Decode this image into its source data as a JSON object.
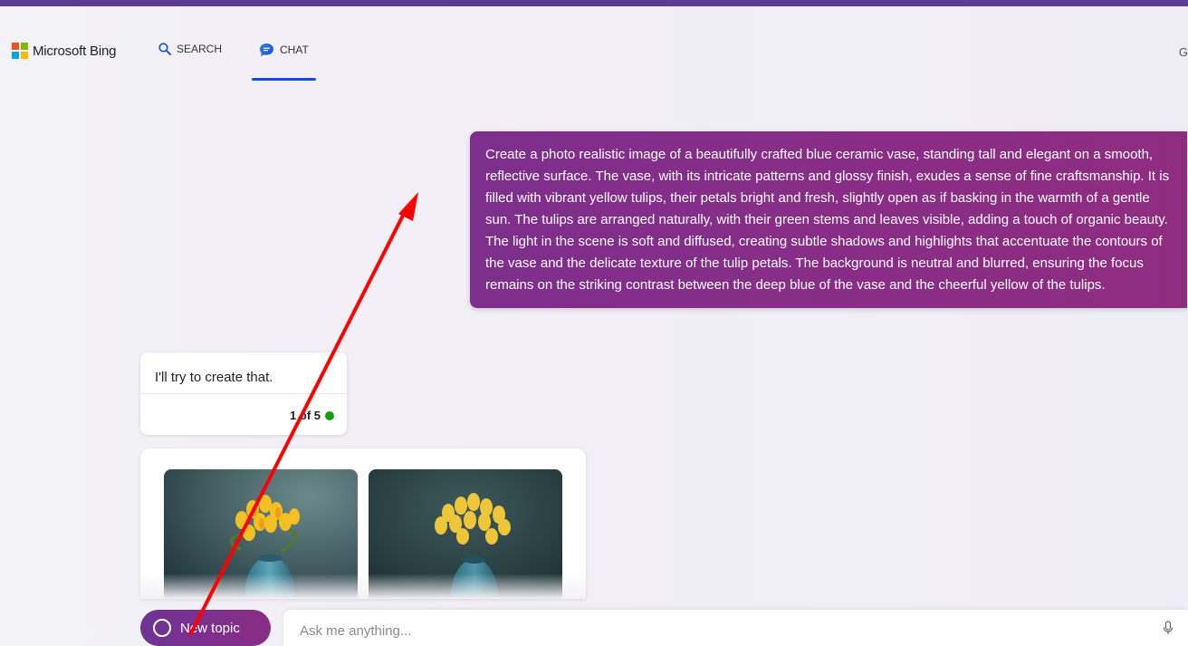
{
  "header": {
    "brand": "Microsoft Bing",
    "nav": {
      "search_label": "SEARCH",
      "chat_label": "CHAT"
    },
    "user_initial": "G"
  },
  "conversation": {
    "user_message": "Create a photo realistic  image of a beautifully crafted blue ceramic vase, standing tall and elegant on a smooth, reflective surface. The vase, with its intricate patterns and glossy finish, exudes a sense of fine craftsmanship. It is filled with vibrant yellow tulips, their petals bright and fresh, slightly open as if basking in the warmth of a gentle sun. The tulips are arranged naturally, with their green stems and leaves visible, adding a touch of organic beauty. The light in the scene is soft and diffused, creating subtle shadows and highlights that accentuate the contours of the vase and the delicate texture of the tulip petals. The background is neutral and blurred, ensuring the focus remains on the striking contrast between the deep blue of the vase and the cheerful yellow of the tulips.",
    "bot_reply": "I'll try to create that.",
    "bot_counter": "1 of 5"
  },
  "images": [
    {
      "icon": "tulip-vase-image-1"
    },
    {
      "icon": "tulip-vase-image-2"
    }
  ],
  "composer": {
    "new_topic_label": "New topic",
    "placeholder": "Ask me anything..."
  },
  "colors": {
    "accent_purple": "#8a2d86",
    "chat_underline": "#174ae4",
    "status_green": "#13a10e",
    "annotation_arrow": "#ff0000"
  }
}
